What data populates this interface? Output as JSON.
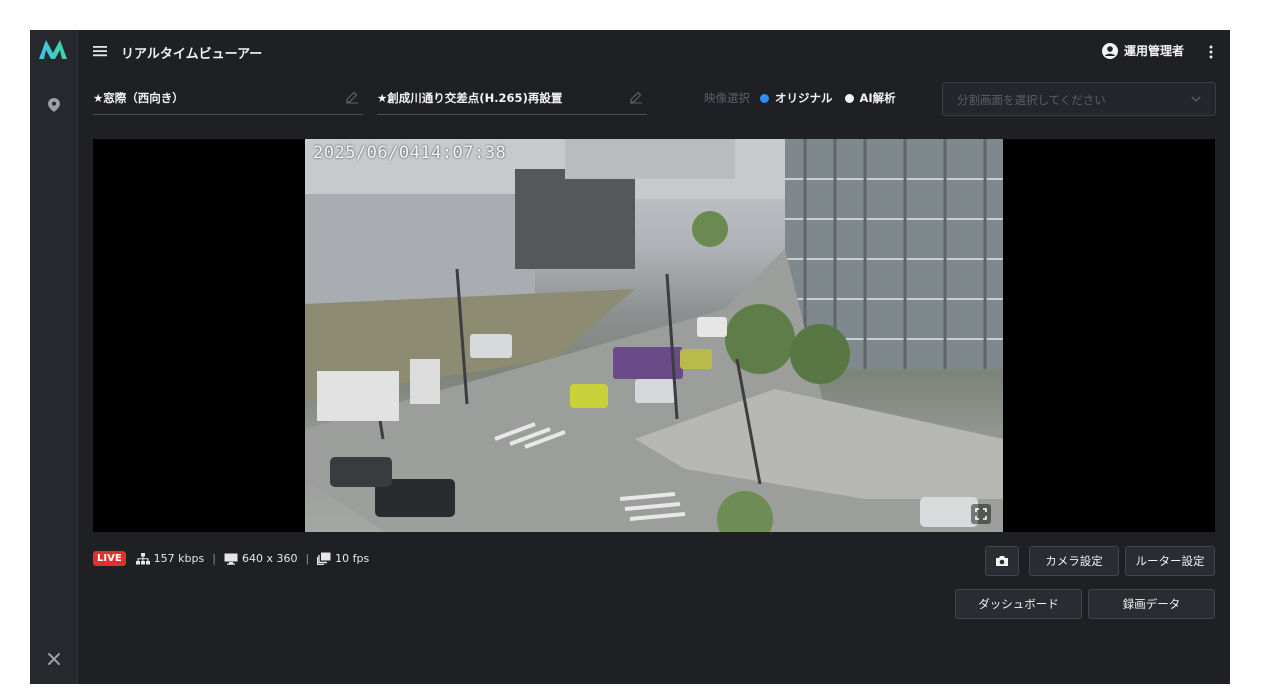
{
  "topbar": {
    "title": "リアルタイムビューアー",
    "user_name": "運用管理者"
  },
  "filters": {
    "location_value": "★窓際（西向き）",
    "camera_value": "★創成川通り交差点(H.265)再設置",
    "video_select_label": "映像選択",
    "option_original": "オリジナル",
    "option_ai": "AI解析",
    "split_placeholder": "分割画面を選択してください"
  },
  "video": {
    "timestamp": "2025/06/0414:07:38"
  },
  "status": {
    "live_label": "LIVE",
    "bitrate": "157 kbps",
    "resolution": "640 x 360",
    "framerate": "10 fps"
  },
  "buttons": {
    "camera_settings": "カメラ設定",
    "router_settings": "ルーター設定",
    "dashboard": "ダッシュボード",
    "recording_data": "録画データ"
  },
  "colors": {
    "accent_blue": "#2f8cf0",
    "live_red": "#e0302a",
    "logo_teal": "#3dd6c8"
  },
  "icons": [
    "logo-icon",
    "location-pin-icon",
    "tools-icon",
    "hamburger-icon",
    "user-circle-icon",
    "kebab-icon",
    "edit-icon",
    "chevron-down-icon",
    "network-icon",
    "monitor-icon",
    "frames-icon",
    "camera-icon",
    "fullscreen-icon"
  ]
}
